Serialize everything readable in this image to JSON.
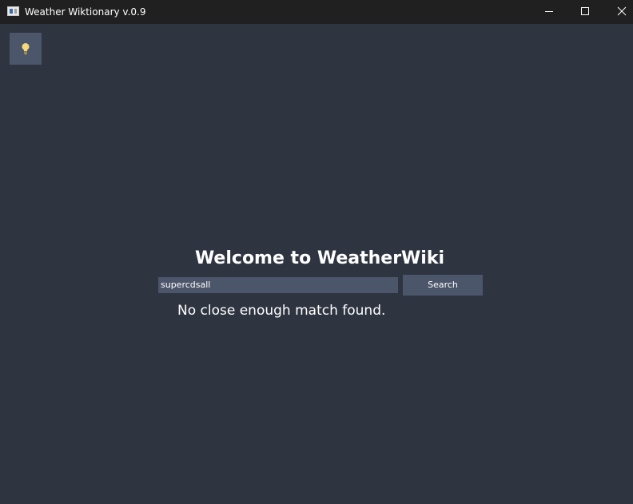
{
  "window": {
    "title": "Weather Wiktionary v.0.9",
    "controls": {
      "minimize_icon": "minimize-icon",
      "maximize_icon": "maximize-icon",
      "close_icon": "close-icon"
    }
  },
  "toolbar": {
    "theme_toggle_icon": "lightbulb-icon"
  },
  "main": {
    "heading": "Welcome to WeatherWiki",
    "search": {
      "value": "supercdsall",
      "placeholder": ""
    },
    "search_button_label": "Search",
    "result_message": "No close enough match found."
  },
  "colors": {
    "background": "#2e3440",
    "titlebar": "#202020",
    "control_fill": "#4c566a",
    "text": "#ffffff",
    "bulb": "#f6d87a"
  }
}
